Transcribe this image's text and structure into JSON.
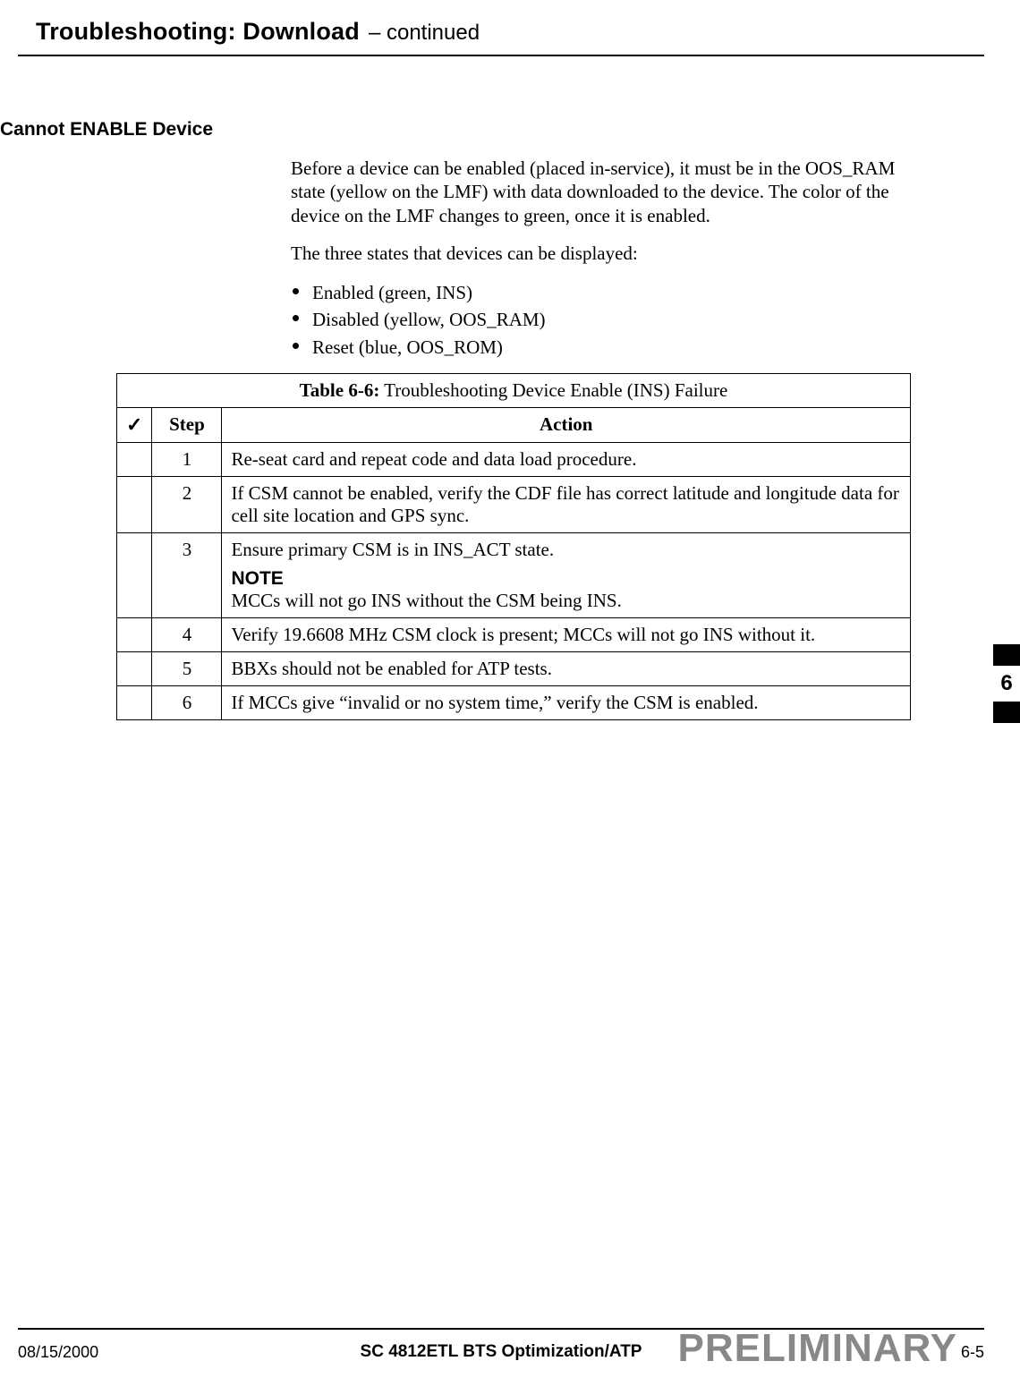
{
  "header": {
    "title_main": "Troubleshooting: Download",
    "title_suffix": "– continued"
  },
  "section": {
    "heading": "Cannot ENABLE Device"
  },
  "body": {
    "para1": "Before a device can be enabled (placed in-service), it must be in the OOS_RAM state (yellow on the LMF) with data downloaded to the device. The color of the device on the LMF changes to green, once it is enabled.",
    "para2": "The three states that devices can be displayed:",
    "bullets": [
      "Enabled (green, INS)",
      "Disabled (yellow, OOS_RAM)",
      "Reset (blue, OOS_ROM)"
    ]
  },
  "table": {
    "title_bold": "Table 6-6:",
    "title_rest": " Troubleshooting Device Enable (INS) Failure",
    "col_check": "✓",
    "col_step": "Step",
    "col_action": "Action",
    "rows": [
      {
        "step": "1",
        "action": "Re-seat card and repeat code and data load procedure."
      },
      {
        "step": "2",
        "action": "If CSM cannot be enabled, verify the CDF file has correct latitude and longitude data for cell site location and GPS sync."
      },
      {
        "step": "3",
        "action": "Ensure primary CSM is in INS_ACT state.",
        "note_label": "NOTE",
        "note_body": "MCCs will not go INS without the CSM being INS."
      },
      {
        "step": "4",
        "action": "Verify 19.6608 MHz CSM clock is present; MCCs will not go INS without it."
      },
      {
        "step": "5",
        "action": "BBXs should not be enabled for ATP tests."
      },
      {
        "step": "6",
        "action": "If MCCs give “invalid or no system time,” verify the CSM is enabled."
      }
    ]
  },
  "side_tab": {
    "number": "6"
  },
  "footer": {
    "date": "08/15/2000",
    "center": "SC 4812ETL BTS Optimization/ATP",
    "page": "6-5",
    "watermark": "PRELIMINARY"
  }
}
